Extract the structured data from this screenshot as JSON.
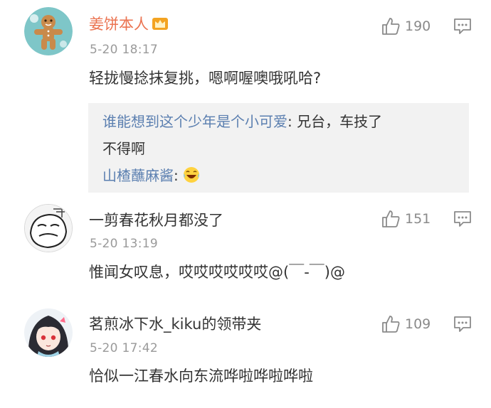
{
  "comments": [
    {
      "username": "姜饼本人",
      "timestamp": "5-20 18:17",
      "text": "轻拢慢捻抹复挑，嗯啊喔噢哦吼哈?",
      "likes": "190",
      "reply": {
        "line1_user": "谁能想到这个少年是个小可爱",
        "line1_sep": ": ",
        "line1_text": "兄台，车技了",
        "line2_text": "不得啊",
        "line3_user": "山楂蘸麻酱",
        "line3_sep": ": ",
        "line3_emoji": "laughing-emoji"
      }
    },
    {
      "username": "一剪春花秋月都没了",
      "timestamp": "5-20 13:19",
      "text": "惟闻女叹息，哎哎哎哎哎哎@(￣-￣)@",
      "likes": "151"
    },
    {
      "username": "茗煎冰下水_kiku的领带夹",
      "timestamp": "5-20 17:42",
      "text": "恰似一江春水向东流哗啦哗啦哗啦",
      "likes": "109"
    }
  ],
  "colors": {
    "username_highlight": "#eb7350",
    "link": "#5b7fb0",
    "timestamp": "#9a9a9a",
    "reply_bg": "#f2f2f2"
  },
  "icons": [
    "thumbs-up-icon",
    "comment-icon",
    "crown-icon"
  ]
}
